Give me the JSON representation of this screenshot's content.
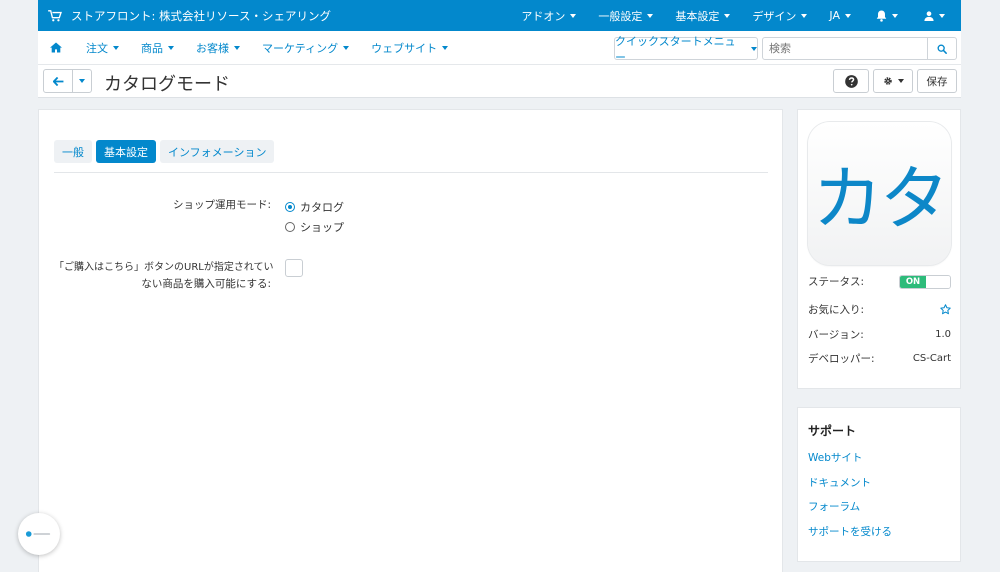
{
  "topbar": {
    "store_label": "ストアフロント: 株式会社リソース・シェアリング",
    "menu": [
      "アドオン",
      "一般設定",
      "基本設定",
      "デザイン",
      "JA"
    ]
  },
  "navbar": {
    "items": [
      "注文",
      "商品",
      "お客様",
      "マーケティング",
      "ウェブサイト"
    ],
    "quickstart_label": "クイックスタートメニュー",
    "search_placeholder": "検索"
  },
  "titlebar": {
    "title": "カタログモード",
    "save_label": "保存"
  },
  "tabs": [
    "一般",
    "基本設定",
    "インフォメーション"
  ],
  "active_tab": "基本設定",
  "settings": {
    "shop_mode_label": "ショップ運用モード:",
    "options": [
      "カタログ",
      "ショップ"
    ],
    "selected_option": "カタログ",
    "buy_now_label_1": "「ご購入はこちら」ボタンのURLが指定されてい",
    "buy_now_label_2": "ない商品を購入可能にする:",
    "buy_now_checked": false
  },
  "addon_info": {
    "icon_text": "カタ",
    "status_label": "ステータス:",
    "status_value": "ON",
    "favorite_label": "お気に入り:",
    "version_label": "バージョン:",
    "version_value": "1.0",
    "developer_label": "デベロッパー:",
    "developer_value": "CS-Cart"
  },
  "support": {
    "heading": "サポート",
    "links": [
      "Webサイト",
      "ドキュメント",
      "フォーラム",
      "サポートを受ける"
    ]
  },
  "colors": {
    "brand_blue": "#0388cc",
    "toggle_on": "#2dbb7a"
  }
}
